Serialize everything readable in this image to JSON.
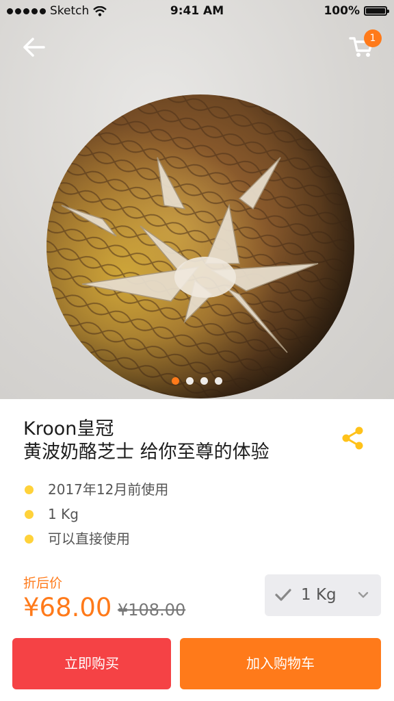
{
  "status_bar": {
    "carrier": "Sketch",
    "time": "9:41 AM",
    "battery": "100%"
  },
  "header": {
    "back_icon": "arrow-left-icon",
    "cart_icon": "shopping-cart-icon",
    "cart_count": "1"
  },
  "carousel": {
    "image_subject": "pineapple",
    "slide_count": 4,
    "active_index": 0
  },
  "product": {
    "title_line1": "Kroon皇冠",
    "title_line2": "黄波奶酪芝士 给你至尊的体验",
    "share_icon": "share-icon",
    "features": [
      "2017年12月前使用",
      "1 Kg",
      "可以直接使用"
    ],
    "price_label": "折后价",
    "price": "¥68.00",
    "original_price": "¥108.00",
    "spec_selected": "1 Kg"
  },
  "actions": {
    "buy_now": "立即购买",
    "add_to_cart": "加入购物车"
  },
  "colors": {
    "accent": "#ff7a1a",
    "buy_now_bg": "#f54245",
    "bullet": "#ffd23a",
    "spec_bg": "#ececef"
  }
}
